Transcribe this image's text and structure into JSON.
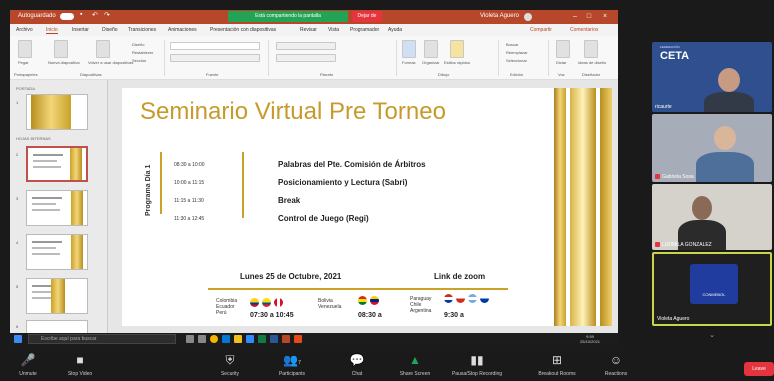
{
  "ppt": {
    "autosave_label": "Autoguardado",
    "share_banner": "Está compartiendo la pantalla",
    "stop_share": "Dejar de",
    "user": "Violeta Aguero",
    "tabs": [
      "Archivo",
      "Inicio",
      "Insertar",
      "Diseño",
      "Transiciones",
      "Animaciones",
      "Presentación con diapositivas",
      "Revisar",
      "Vista",
      "Programador",
      "Ayuda"
    ],
    "share_link": "Compartir",
    "comments_link": "Comentarios",
    "ribbon_labels": [
      "Pegar",
      "Nueva diapositiva",
      "Volver a usar diapositivas",
      "Diseño",
      "Restablecer",
      "Sección",
      "Fuente",
      "Párrafo",
      "Formas",
      "Organizar",
      "Estilos rápidos",
      "Buscar",
      "Reemplazar",
      "Seleccionar",
      "Dictar",
      "Ideas de diseño"
    ],
    "ribbon_groups": [
      "Portapapeles",
      "Diapositivas",
      "Fuente",
      "Párrafo",
      "Dibujo",
      "Edición",
      "Voz",
      "Diseñador"
    ],
    "sections": [
      "PORTADA",
      "HOJAS INTERNAS"
    ],
    "thumb_numbers": [
      "1",
      "2",
      "3",
      "4",
      "5",
      "6"
    ],
    "status_left": "Diapositiva 2 de 6",
    "status_lang": "Portugués (Brasil)",
    "status_notes": "Notas",
    "status_zoom": "93%"
  },
  "slide": {
    "title": "Seminario Virtual Pre Torneo",
    "program_label": "Programa Día 1",
    "schedule": [
      {
        "time": "08:30 a 10:00",
        "activity": "Palabras del Pte. Comisión de Árbitros"
      },
      {
        "time": "10:00 a 11:15",
        "activity": "Posicionamiento y Lectura (Sabri)"
      },
      {
        "time": "11:15 a 11:30",
        "activity": "Break"
      },
      {
        "time": "11:30 a 12:45",
        "activity": "Control de Juego (Regi)"
      }
    ],
    "date": "Lunes 25 de Octubre, 2021",
    "zoom_link": "Link de zoom",
    "groups": [
      {
        "countries": "Colombia\nEcuador\nPerú",
        "time": "07:30 a 10:45"
      },
      {
        "countries": "Bolivia\nVenezuela",
        "time": "08:30 a"
      },
      {
        "countries": "Paraguay\nChile\nArgentina",
        "time": "9:30 a"
      }
    ]
  },
  "participants": [
    {
      "name": "ricaurte",
      "logo": "CETA",
      "logo_sub": "FEDERACIÓN"
    },
    {
      "name": "Gabriela Sosa"
    },
    {
      "name": "LUDMILA GONZALEZ"
    },
    {
      "name": "Violeta Aguero",
      "logo": "CONMEBOL"
    }
  ],
  "taskbar": {
    "search_placeholder": "Escribe aquí para buscar",
    "clock_time": "9:59",
    "clock_date": "25/10/2021"
  },
  "zoom_toolbar": [
    {
      "label": "Unmute",
      "icon": "microphone-icon"
    },
    {
      "label": "Stop Video",
      "icon": "camera-icon"
    },
    {
      "label": "Security",
      "icon": "shield-icon"
    },
    {
      "label": "Participants",
      "icon": "participants-icon",
      "count": "7"
    },
    {
      "label": "Chat",
      "icon": "chat-icon"
    },
    {
      "label": "Share Screen",
      "icon": "share-screen-icon"
    },
    {
      "label": "Pausa/Stop Recording",
      "icon": "record-icon"
    },
    {
      "label": "Breakout Rooms",
      "icon": "breakout-icon"
    },
    {
      "label": "Reactions",
      "icon": "reactions-icon"
    }
  ],
  "leave": "Leave",
  "colors": {
    "ppt_accent": "#b7472a",
    "zoom_green": "#23a455",
    "stop_red": "#e5343d",
    "gold": "#c9a227"
  }
}
